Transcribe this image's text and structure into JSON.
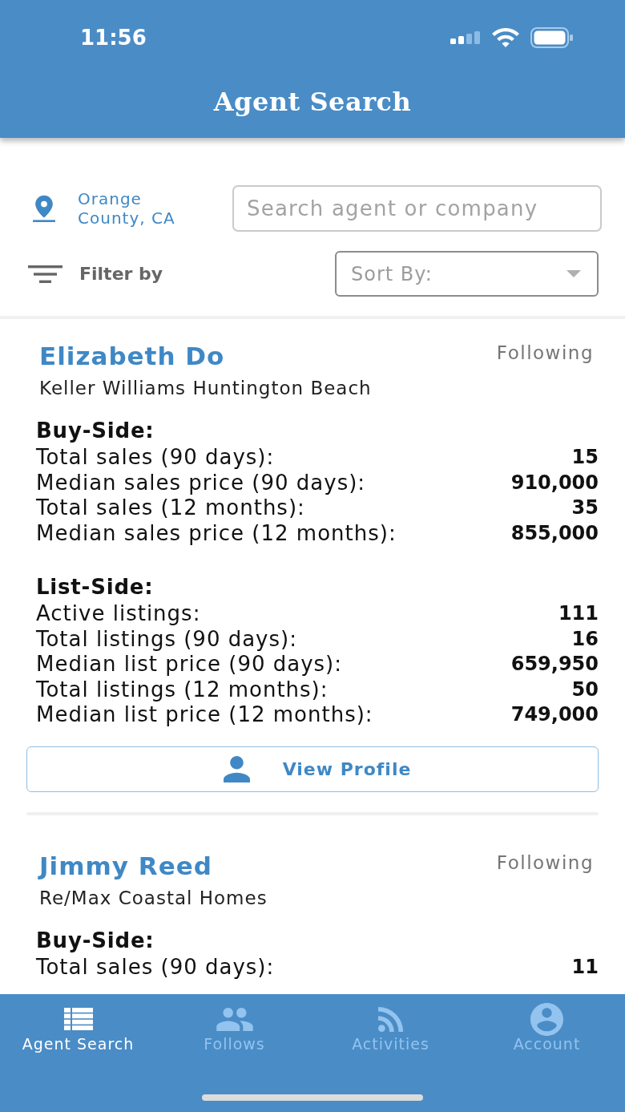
{
  "status_bar": {
    "time": "11:56"
  },
  "header": {
    "title": "Agent Search"
  },
  "filters": {
    "location": "Orange County, CA",
    "search": {
      "placeholder": "Search agent or company"
    },
    "filter_label": "Filter by",
    "sort": {
      "placeholder": "Sort By:"
    }
  },
  "agents": [
    {
      "name": "Elizabeth Do",
      "follow_label": "Following",
      "company": "Keller Williams Huntington Beach",
      "sections": [
        {
          "title": "Buy-Side:",
          "rows": [
            {
              "label": "Total sales (90 days):",
              "value": "15"
            },
            {
              "label": "Median sales price (90 days):",
              "value": "910,000"
            },
            {
              "label": "Total sales (12 months):",
              "value": "35"
            },
            {
              "label": "Median sales price (12 months):",
              "value": "855,000"
            }
          ]
        },
        {
          "title": "List-Side:",
          "rows": [
            {
              "label": "Active listings:",
              "value": "111"
            },
            {
              "label": "Total listings (90 days):",
              "value": "16"
            },
            {
              "label": "Median list price (90 days):",
              "value": "659,950"
            },
            {
              "label": "Total listings (12 months):",
              "value": "50"
            },
            {
              "label": "Median list price (12 months):",
              "value": "749,000"
            }
          ]
        }
      ],
      "button": "View Profile"
    },
    {
      "name": "Jimmy Reed",
      "follow_label": "Following",
      "company": "Re/Max Coastal Homes",
      "sections": [
        {
          "title": "Buy-Side:",
          "rows": [
            {
              "label": "Total sales (90 days):",
              "value": "11"
            }
          ]
        }
      ]
    }
  ],
  "tab_bar": {
    "tabs": [
      {
        "label": "Agent Search",
        "selected": true
      },
      {
        "label": "Follows",
        "selected": false
      },
      {
        "label": "Activities",
        "selected": false
      },
      {
        "label": "Account",
        "selected": false
      }
    ]
  }
}
